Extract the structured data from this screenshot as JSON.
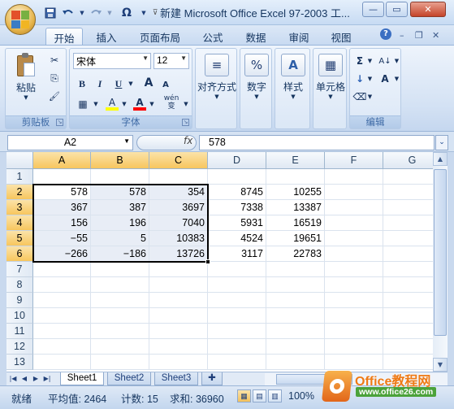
{
  "window": {
    "title": "新建 Microsoft Office Excel 97-2003 工...",
    "minimize_icon": "minimize-icon",
    "maximize_icon": "maximize-icon",
    "close_icon": "close-icon",
    "close_glyph": "✕",
    "min_glyph": "—",
    "max_glyph": "▭"
  },
  "qat": {
    "save_icon": "save-icon",
    "undo_icon": "undo-icon",
    "redo_icon": "redo-icon",
    "omega_label": "Ω",
    "customize_icon": "chevron-down-icon"
  },
  "ribbon_tabs": [
    "开始",
    "插入",
    "页面布局",
    "公式",
    "数据",
    "审阅",
    "视图"
  ],
  "ribbon_right": {
    "help": "?",
    "min": "–",
    "restore": "❐",
    "close": "✕"
  },
  "clipboard": {
    "paste_label": "粘贴",
    "group_label": "剪贴板",
    "cut_glyph": "✂",
    "copy_glyph": "⎘",
    "brush_glyph": "🖌"
  },
  "font": {
    "name": "宋体",
    "size": "12",
    "bold": "B",
    "italic": "I",
    "underline": "U",
    "grow": "A",
    "shrink": "A",
    "phonetic": "wén\n变",
    "border_glyph": "▦",
    "fill_glyph": "A",
    "color_glyph": "A",
    "group_label": "字体",
    "fill_color": "#ffff00",
    "font_color": "#ff0000"
  },
  "groups": {
    "alignment": "对齐方式",
    "number": "数字",
    "styles": "样式",
    "cells": "单元格",
    "editing": "编辑",
    "number_glyph": "%",
    "align_glyph": "≡",
    "styles_glyph": "A",
    "cells_glyph": "▦",
    "sum_glyph": "Σ",
    "sort_glyph": "A↓",
    "fill_glyph": "↓",
    "find_glyph": "A",
    "clear_glyph": "⌫"
  },
  "formula_bar": {
    "name_box": "A2",
    "fx": "fx",
    "value": "578"
  },
  "columns": [
    "A",
    "B",
    "C",
    "D",
    "E",
    "F",
    "G"
  ],
  "rows": [
    "1",
    "2",
    "3",
    "4",
    "5",
    "6",
    "7",
    "8",
    "9",
    "10",
    "11",
    "12",
    "13"
  ],
  "cells": [
    [
      "",
      "",
      "",
      "",
      "",
      "",
      ""
    ],
    [
      "578",
      "578",
      "354",
      "8745",
      "10255",
      "",
      ""
    ],
    [
      "367",
      "387",
      "3697",
      "7338",
      "13387",
      "",
      ""
    ],
    [
      "156",
      "196",
      "7040",
      "5931",
      "16519",
      "",
      ""
    ],
    [
      "−55",
      "5",
      "10383",
      "4524",
      "19651",
      "",
      ""
    ],
    [
      "−266",
      "−186",
      "13726",
      "3117",
      "22783",
      "",
      ""
    ],
    [
      "",
      "",
      "",
      "",
      "",
      "",
      ""
    ],
    [
      "",
      "",
      "",
      "",
      "",
      "",
      ""
    ],
    [
      "",
      "",
      "",
      "",
      "",
      "",
      ""
    ],
    [
      "",
      "",
      "",
      "",
      "",
      "",
      ""
    ],
    [
      "",
      "",
      "",
      "",
      "",
      "",
      ""
    ],
    [
      "",
      "",
      "",
      "",
      "",
      "",
      ""
    ],
    [
      "",
      "",
      "",
      "",
      "",
      "",
      ""
    ]
  ],
  "sheets": [
    "Sheet1",
    "Sheet2",
    "Sheet3"
  ],
  "status": {
    "ready": "就绪",
    "average": "平均值: 2464",
    "count": "计数: 15",
    "sum": "求和: 36960",
    "zoom": "100%"
  },
  "watermark": {
    "brand": "Office教程网",
    "url": "www.office26.com"
  }
}
